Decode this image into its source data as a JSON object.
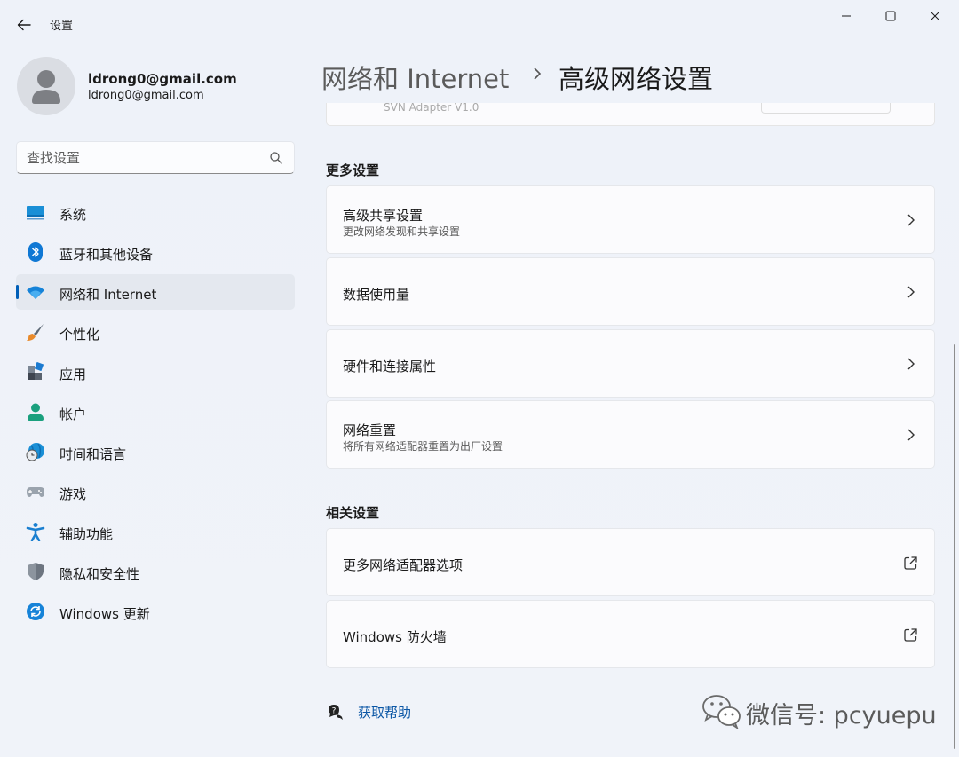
{
  "app": {
    "title": "设置"
  },
  "window_controls": {
    "minimize_icon": "minimize-icon",
    "maximize_icon": "maximize-icon",
    "close_icon": "close-icon"
  },
  "profile": {
    "name": "ldrong0@gmail.com",
    "email": "ldrong0@gmail.com"
  },
  "search": {
    "placeholder": "查找设置",
    "icon": "search-icon"
  },
  "sidebar": {
    "items": [
      {
        "label": "系统",
        "icon": "system-icon",
        "active": false
      },
      {
        "label": "蓝牙和其他设备",
        "icon": "bluetooth-icon",
        "active": false
      },
      {
        "label": "网络和 Internet",
        "icon": "wifi-icon",
        "active": true
      },
      {
        "label": "个性化",
        "icon": "brush-icon",
        "active": false
      },
      {
        "label": "应用",
        "icon": "apps-icon",
        "active": false
      },
      {
        "label": "帐户",
        "icon": "account-icon",
        "active": false
      },
      {
        "label": "时间和语言",
        "icon": "globe-clock-icon",
        "active": false
      },
      {
        "label": "游戏",
        "icon": "gamepad-icon",
        "active": false
      },
      {
        "label": "辅助功能",
        "icon": "accessibility-icon",
        "active": false
      },
      {
        "label": "隐私和安全性",
        "icon": "shield-icon",
        "active": false
      },
      {
        "label": "Windows 更新",
        "icon": "update-icon",
        "active": false
      }
    ],
    "accent_color": "#005fb8"
  },
  "breadcrumb": {
    "parent": "网络和 Internet",
    "current": "高级网络设置"
  },
  "partial_card": {
    "text": "SVN Adapter V1.0"
  },
  "more_settings": {
    "title": "更多设置",
    "items": [
      {
        "title": "高级共享设置",
        "subtitle": "更改网络发现和共享设置"
      },
      {
        "title": "数据使用量"
      },
      {
        "title": "硬件和连接属性"
      },
      {
        "title": "网络重置",
        "subtitle": "将所有网络适配器重置为出厂设置"
      }
    ]
  },
  "related_settings": {
    "title": "相关设置",
    "items": [
      {
        "title": "更多网络适配器选项",
        "icon": "external-link-icon"
      },
      {
        "title": "Windows 防火墙",
        "icon": "external-link-icon"
      }
    ]
  },
  "help": {
    "label": "获取帮助",
    "icon": "help-chat-icon"
  },
  "watermark": {
    "text": "微信号: pcyuepu",
    "icon": "wechat-icon"
  }
}
